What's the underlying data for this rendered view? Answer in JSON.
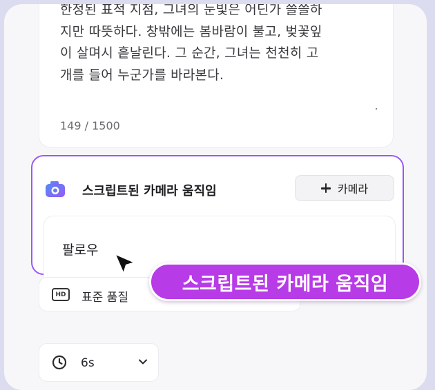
{
  "prompt_card": {
    "story_text": "한정된 표적 지점, 그녀의 눈빛은 어딘가 쓸쓸하\n지만 따뜻하다. 창밖에는 봄바람이 불고, 벚꽃잎\n이 살며시 흩날린다. 그 순간, 그녀는 천천히 고\n개를 들어 누군가를 바라본다.",
    "char_counter": "149 / 1500"
  },
  "camera_panel": {
    "icon": "camera-icon",
    "title": "스크립트된 카메라 움직임",
    "add_button_label": "카메라",
    "movement_value": "팔로우",
    "accent_color": "#9b57f4"
  },
  "quality": {
    "icon": "hd-icon",
    "badge": "HD",
    "label": "표준 품질"
  },
  "duration": {
    "icon": "clock-icon",
    "value": "6s"
  },
  "tooltip": {
    "text": "스크립트된 카메라 움직임",
    "color": "#b73be6"
  }
}
